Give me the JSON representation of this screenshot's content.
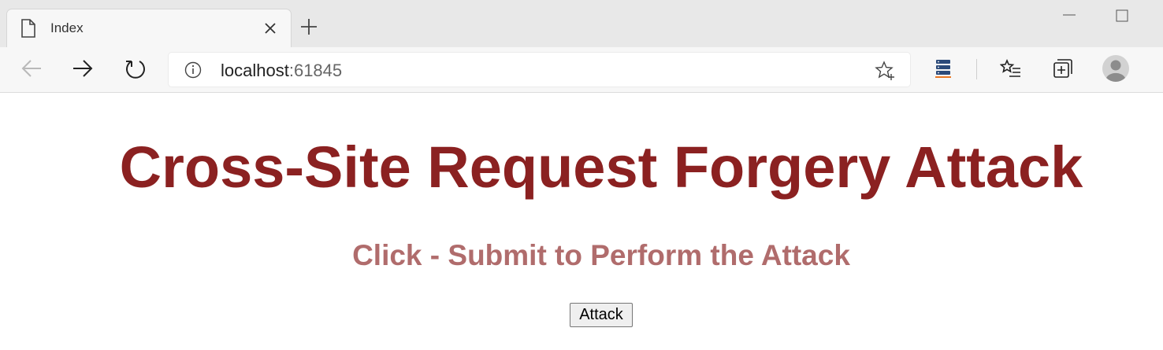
{
  "browser": {
    "tab": {
      "title": "Index"
    },
    "address_bar": {
      "host": "localhost",
      "port": ":61845"
    },
    "icons": {
      "tab_page": "page-icon",
      "tab_close": "close-icon",
      "new_tab": "plus-icon",
      "minimize": "minimize-icon",
      "maximize": "maximize-icon",
      "back": "back-arrow-icon",
      "forward": "forward-arrow-icon",
      "refresh": "refresh-icon",
      "site_info": "info-icon",
      "favorite": "star-add-icon",
      "extension": "server-stack-icon",
      "favorites": "favorites-list-icon",
      "collections": "collections-icon",
      "profile": "avatar-icon"
    },
    "colors": {
      "extension_accent": "#e87722"
    }
  },
  "page": {
    "title": "Cross-Site Request Forgery Attack",
    "subtitle": "Click - Submit to Perform the Attack",
    "submit_button_label": "Attack",
    "colors": {
      "title": "#8b2121",
      "subtitle": "#b06c6c"
    }
  }
}
